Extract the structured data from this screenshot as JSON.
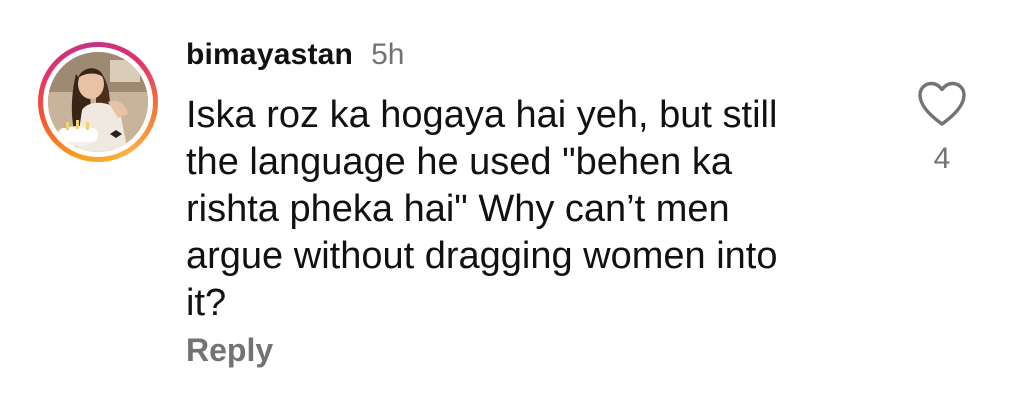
{
  "comment": {
    "username": "bimayastan",
    "timestamp": "5h",
    "text": "Iska roz ka hogaya hai yeh, but still\nthe language he used \"behen ka\nrishta pheka hai\" Why can’t men\nargue without dragging women into\nit?",
    "reply_label": "Reply",
    "like_count": "4",
    "icons": {
      "like": "heart-outline-icon",
      "avatar": "profile-photo"
    },
    "colors": {
      "text_primary": "#111111",
      "text_secondary": "#737373",
      "story_ring_start": "#f9a01b",
      "story_ring_mid": "#e1306c",
      "story_ring_end": "#c13584"
    }
  }
}
